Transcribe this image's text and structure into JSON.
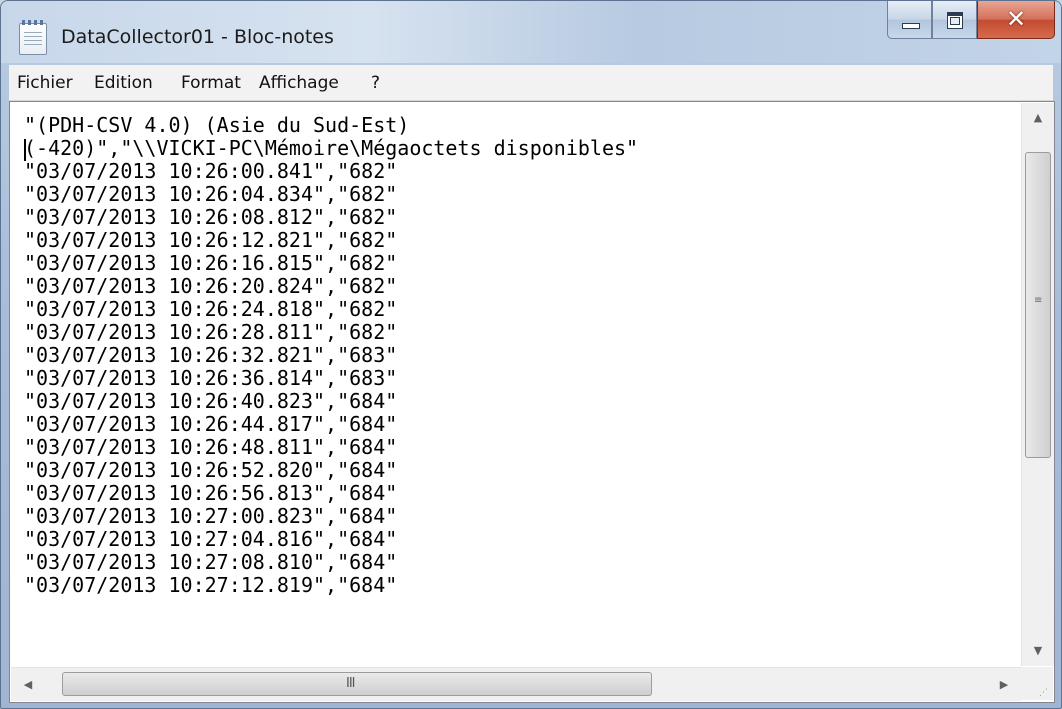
{
  "window": {
    "title": "DataCollector01 - Bloc-notes",
    "accent_close_color": "#c24a30",
    "app_icon": "notepad-icon"
  },
  "caption_buttons": {
    "minimize_icon": "minimize-icon",
    "maximize_icon": "maximize-icon",
    "close_icon": "close-icon",
    "close_glyph": "✕"
  },
  "menu": {
    "items": [
      "Fichier",
      "Edition",
      "Format",
      "Affichage",
      "?"
    ]
  },
  "document": {
    "lines": [
      "\"(PDH-CSV 4.0) (Asie du Sud-Est)",
      "(-420)\",\"\\\\VICKI-PC\\Mémoire\\Mégaoctets disponibles\"",
      "\"03/07/2013 10:26:00.841\",\"682\"",
      "\"03/07/2013 10:26:04.834\",\"682\"",
      "\"03/07/2013 10:26:08.812\",\"682\"",
      "\"03/07/2013 10:26:12.821\",\"682\"",
      "\"03/07/2013 10:26:16.815\",\"682\"",
      "\"03/07/2013 10:26:20.824\",\"682\"",
      "\"03/07/2013 10:26:24.818\",\"682\"",
      "\"03/07/2013 10:26:28.811\",\"682\"",
      "\"03/07/2013 10:26:32.821\",\"683\"",
      "\"03/07/2013 10:26:36.814\",\"683\"",
      "\"03/07/2013 10:26:40.823\",\"684\"",
      "\"03/07/2013 10:26:44.817\",\"684\"",
      "\"03/07/2013 10:26:48.811\",\"684\"",
      "\"03/07/2013 10:26:52.820\",\"684\"",
      "\"03/07/2013 10:26:56.813\",\"684\"",
      "\"03/07/2013 10:27:00.823\",\"684\"",
      "\"03/07/2013 10:27:04.816\",\"684\"",
      "\"03/07/2013 10:27:08.810\",\"684\"",
      "\"03/07/2013 10:27:12.819\",\"684\""
    ]
  },
  "scrollbars": {
    "up_arrow": "▲",
    "down_arrow": "▼",
    "left_arrow": "◀",
    "right_arrow": "▶",
    "vertical_grip": "≡",
    "horizontal_grip": "III",
    "size_grip": "⋰"
  }
}
